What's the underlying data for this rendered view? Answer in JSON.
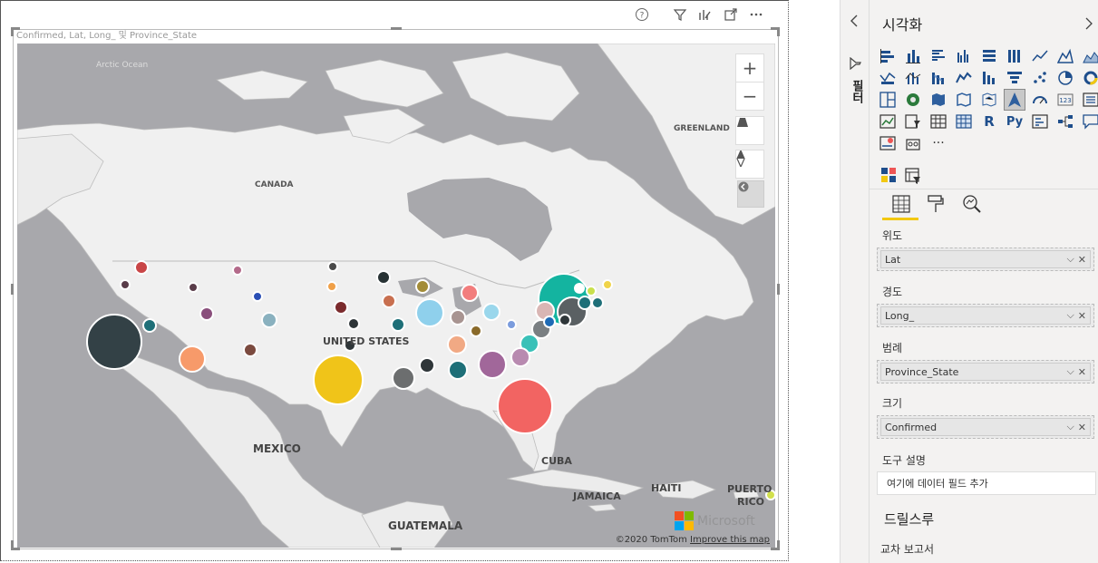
{
  "visual": {
    "title": "Confirmed, Lat, Long_ 및 Province_State",
    "header_icons": [
      "help-icon",
      "filter-icon",
      "focus-icon",
      "expand-icon",
      "more-icon"
    ]
  },
  "map": {
    "labels": {
      "arctic": "Arctic Ocean",
      "greenland": "GREENLAND",
      "canada": "CANADA",
      "us": "UNITED STATES",
      "mexico": "MEXICO",
      "cuba": "CUBA",
      "haiti": "HAITI",
      "jamaica": "JAMAICA",
      "puerto": "PUERTO",
      "rico": "RICO",
      "guatemala": "GUATEMALA"
    },
    "controls": {
      "zoom_in": "+",
      "zoom_out": "−"
    },
    "copyright": "©2020 TomTom",
    "improve_link": "Improve this map",
    "brand": "Microsoft",
    "brand_colors": [
      "#f25022",
      "#7fba00",
      "#00a4ef",
      "#ffb900"
    ]
  },
  "panel": {
    "title": "시각화",
    "filters_label": "필터",
    "fields": [
      {
        "label": "위도",
        "value": "Lat"
      },
      {
        "label": "경도",
        "value": "Long_"
      },
      {
        "label": "범례",
        "value": "Province_State"
      },
      {
        "label": "크기",
        "value": "Confirmed"
      }
    ],
    "tooltip_label": "도구 설명",
    "tooltip_placeholder": "여기에 데이터 필드 추가",
    "drill_title": "드릴스루",
    "cross_report": "교차 보고서",
    "more_visuals": "···",
    "r_label": "R",
    "py_label": "Py",
    "accent": "#f2c811"
  }
}
